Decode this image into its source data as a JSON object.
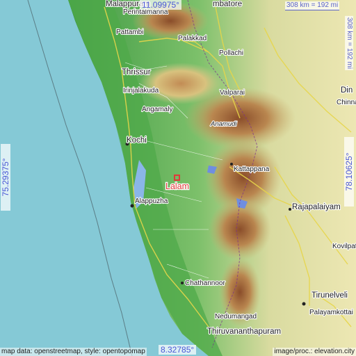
{
  "map": {
    "place": "Lalam",
    "coordinates": {
      "top": "11.09975°",
      "bottom": "8.32785°",
      "left": "75.29375°",
      "right": "78.10625°"
    },
    "scale": {
      "horizontal": "308 km = 192 mi",
      "vertical": "308 km = 192 mi"
    },
    "labels": {
      "malappuram": "Malappuram",
      "perintalmanna": "Perintalmanna",
      "coimbatore": "mbatore",
      "pattambi": "Pattambi",
      "palakkad": "Palakkad",
      "pollachi": "Pollachi",
      "thrissur": "Thrissur",
      "irinjalakuda": "Irinjalakuda",
      "valparai": "Valparai",
      "dindigul": "Din",
      "chinnalapatti": "Chinna",
      "angamaly": "Angamaly",
      "anamudi": "Anamudi",
      "kochi": "Kochi",
      "kattappana": "Kattappana",
      "alappuzha": "Alappuzha",
      "rajapalaiyam": "Rajapalaiyam",
      "kovilpatti": "Kovilpatt",
      "chathannoor": "Chathannoor",
      "tirunelveli": "Tirunelveli",
      "nedumangad": "Nedumangad",
      "palayamkottai": "Palayamkottai",
      "thiruvananthapuram": "Thiruvananthapuram"
    },
    "attribution": {
      "left": "map data: openstreetmap, style: opentopomap",
      "right": "image/proc.: elevation.city"
    },
    "colors": {
      "sea": "#85c9d6",
      "lowland": "#5fb25a",
      "plain": "#e8e6b0",
      "highland": "#a06a3c",
      "pin": "#e03a3a",
      "coord_text": "#4a57d6"
    }
  }
}
